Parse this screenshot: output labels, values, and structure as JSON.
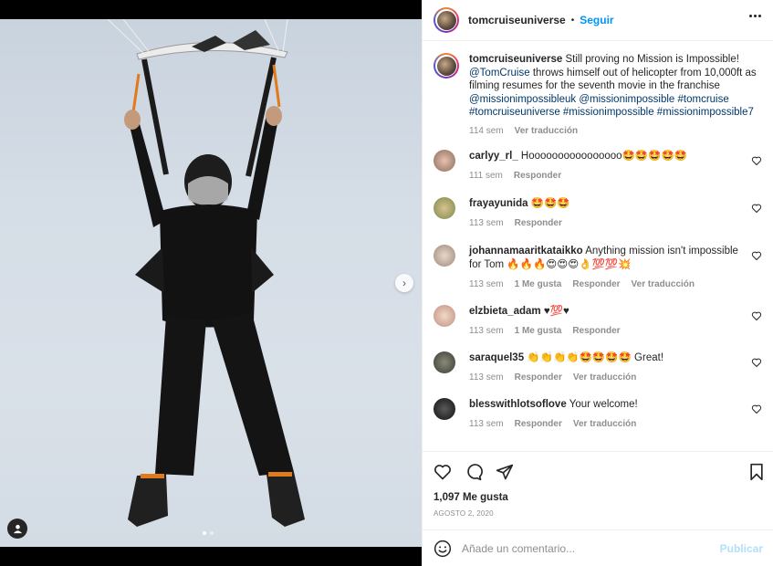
{
  "post": {
    "username": "tomcruiseuniverse",
    "follow_label": "Seguir",
    "separator": "•"
  },
  "caption": {
    "username": "tomcruiseuniverse",
    "text_1": "Still proving no Mission is Impossible!",
    "mention": "@TomCruise",
    "text_2": "throws himself out of helicopter from 10,000ft as filming resumes for the seventh movie in the franchise",
    "hashtags": "@missionimpossibleuk @missionimpossible #tomcruise #tomcruiseuniverse #missionimpossible #missionimpossible7",
    "time": "114 sem",
    "translate": "Ver traducción"
  },
  "comments": [
    {
      "username": "carlyy_rl_",
      "text": "Hoooooooooooooooo🤩🤩🤩🤩🤩",
      "time": "111 sem",
      "likes": "",
      "reply": "Responder",
      "translate": ""
    },
    {
      "username": "frayayunida",
      "text": "🤩🤩🤩",
      "time": "113 sem",
      "likes": "",
      "reply": "Responder",
      "translate": ""
    },
    {
      "username": "johannamaaritkataikko",
      "text": "Anything mission isn't impossible for Tom 🔥🔥🔥😍😍😍👌💯💯💥",
      "time": "113 sem",
      "likes": "1 Me gusta",
      "reply": "Responder",
      "translate": "Ver traducción"
    },
    {
      "username": "elzbieta_adam",
      "text": "♥💯♥",
      "time": "113 sem",
      "likes": "1 Me gusta",
      "reply": "Responder",
      "translate": ""
    },
    {
      "username": "saraquel35",
      "text": "👏👏👏👏🤩🤩🤩🤩 Great!",
      "time": "113 sem",
      "likes": "",
      "reply": "Responder",
      "translate": "Ver traducción"
    },
    {
      "username": "blesswithlotsoflove",
      "text": "Your welcome!",
      "time": "113 sem",
      "likes": "",
      "reply": "Responder",
      "translate": "Ver traducción"
    }
  ],
  "stats": {
    "likes": "1,097 Me gusta",
    "date": "AGOSTO 2, 2020"
  },
  "composer": {
    "placeholder": "Añade un comentario...",
    "publish_label": "Publicar"
  },
  "icons": {
    "more": "more-options-icon",
    "heart": "heart-icon",
    "comment": "comment-icon",
    "share": "share-icon",
    "save": "bookmark-icon",
    "emoji": "emoji-icon",
    "next": "chevron-right-icon",
    "tag": "user-tag-icon"
  },
  "colors": {
    "accent": "#0095f6",
    "link": "#00376b",
    "muted": "#8e8e8e",
    "publish_disabled": "#b2dffc"
  }
}
